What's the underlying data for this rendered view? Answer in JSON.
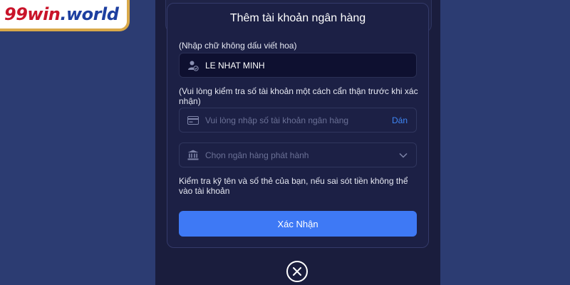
{
  "brand": {
    "part1": "99",
    "part2": "win",
    "part3": ".world"
  },
  "modal": {
    "title": "Thêm tài khoản ngân hàng",
    "name_label": "(Nhập chữ không dấu viết hoa)",
    "name_value": "LE NHAT MINH",
    "account_label": "(Vui lòng kiểm tra số tài khoản một cách cẩn thận trước khi xác nhận)",
    "account_placeholder": "Vui lòng nhập số tài khoản ngân hàng",
    "paste_label": "Dán",
    "bank_placeholder": "Chọn ngân hàng phát hành",
    "warning": "Kiểm tra kỹ tên và số thẻ của bạn, nếu sai sót tiền không thể vào tài khoản",
    "confirm_label": "Xác Nhận"
  },
  "icons": {
    "user": "user-check-icon",
    "card": "credit-card-icon",
    "bank": "bank-icon",
    "dropdown": "chevron-down-icon",
    "close": "close-icon"
  },
  "colors": {
    "accent": "#3e79f5",
    "link": "#3e86f5",
    "modal_bg": "#1c2045",
    "page_bg": "#2c3c72"
  }
}
